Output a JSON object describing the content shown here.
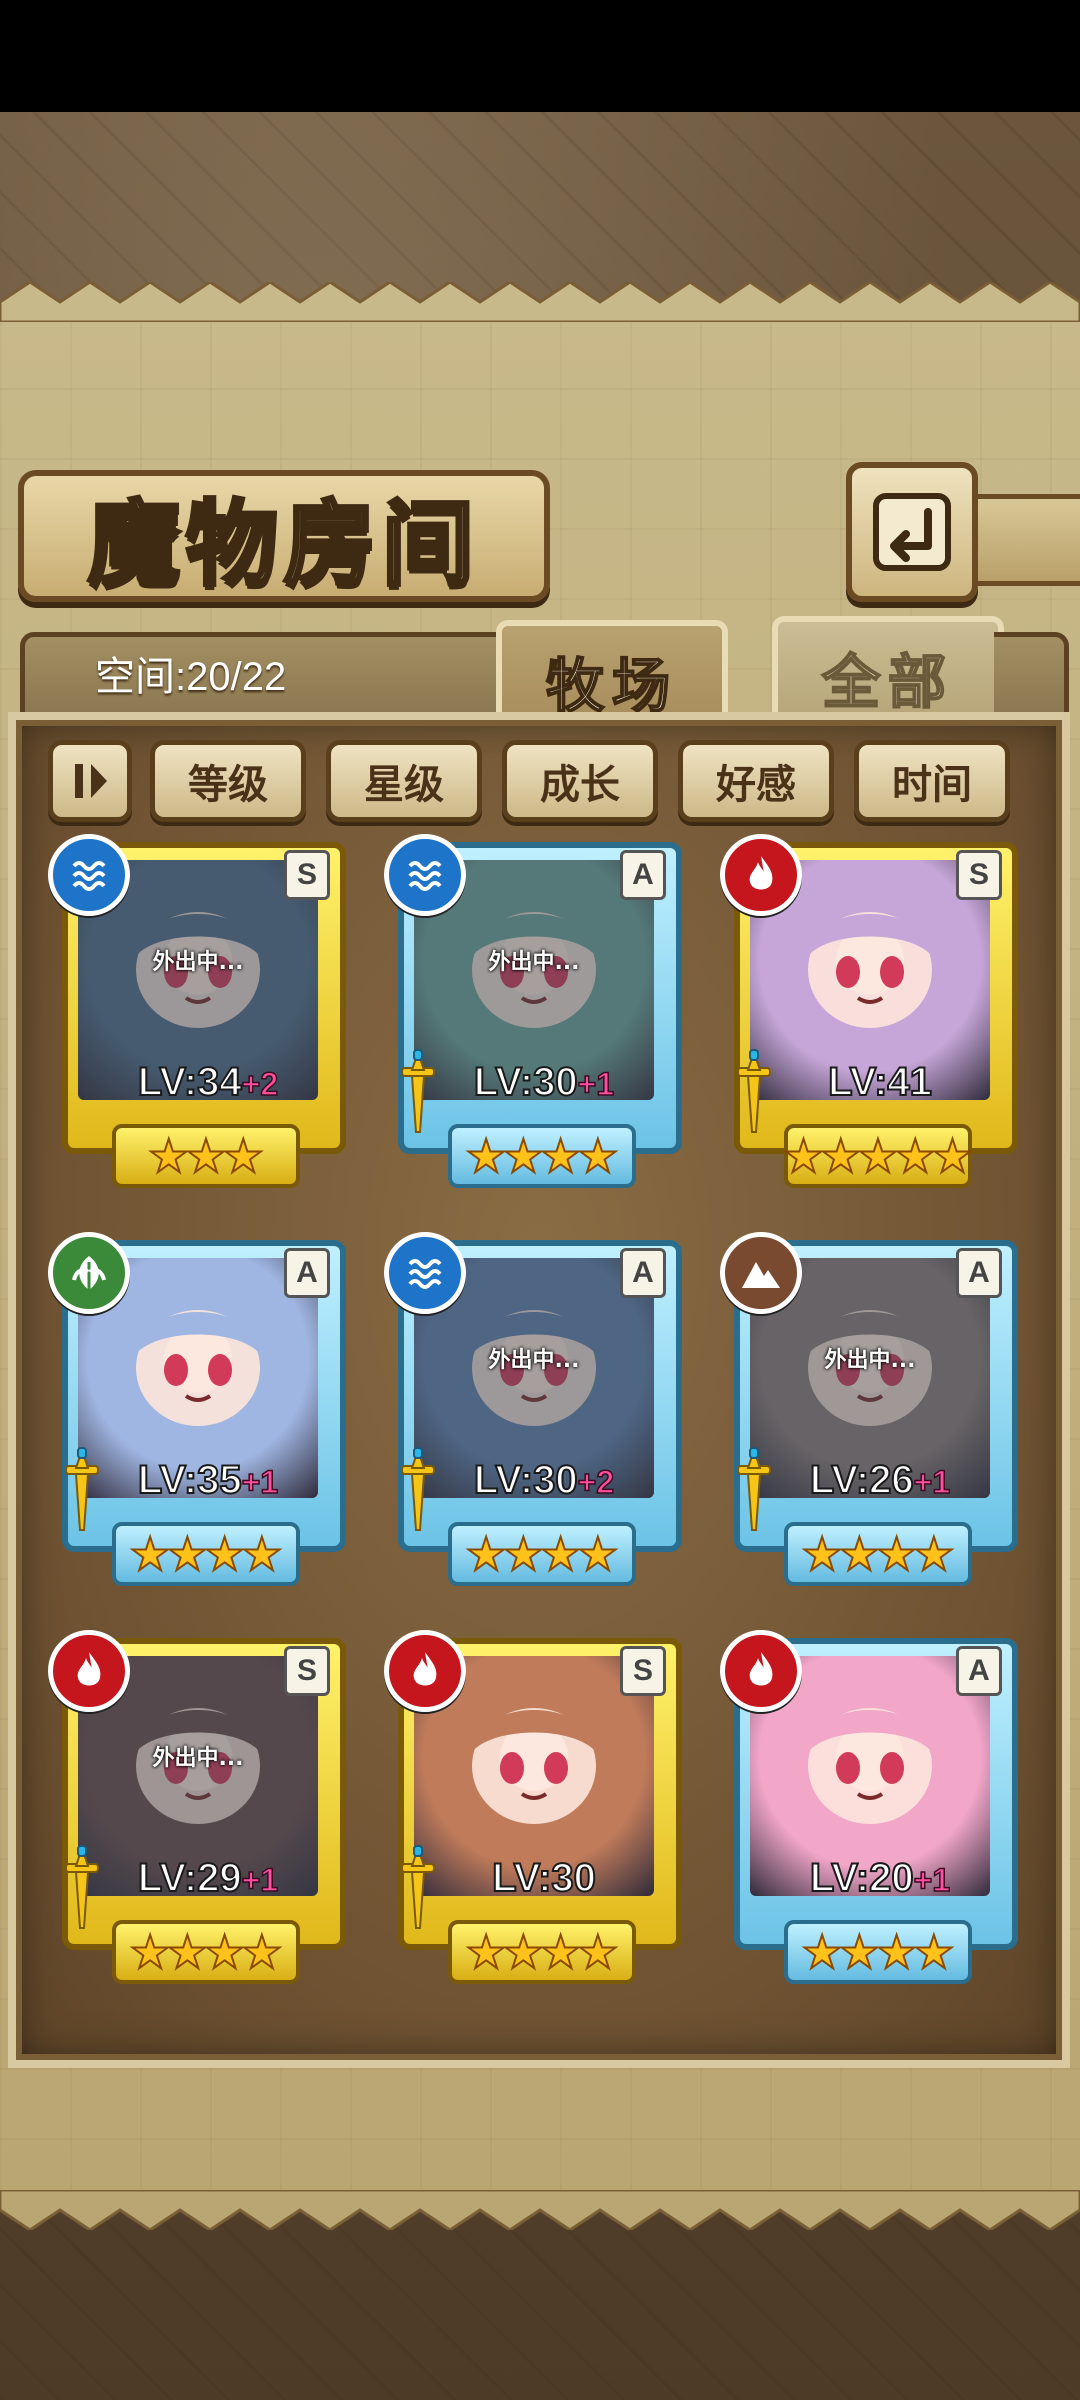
{
  "header": {
    "title": "魔物房间"
  },
  "space": {
    "label": "空间:20/22"
  },
  "tabs": [
    {
      "label": "牧场",
      "active": true
    },
    {
      "label": "全部",
      "active": false
    }
  ],
  "filters": [
    {
      "label": "等级"
    },
    {
      "label": "星级"
    },
    {
      "label": "成长"
    },
    {
      "label": "好感"
    },
    {
      "label": "时间"
    }
  ],
  "status_out": "外出中...",
  "monsters": [
    {
      "element": "water",
      "element_icon": "water-icon",
      "rank": "S",
      "level": "LV:34",
      "bonus": "+2",
      "stars": 3,
      "frame": "gold",
      "out": true,
      "weapon": false,
      "art_color": "#4f6c8a"
    },
    {
      "element": "water",
      "element_icon": "water-icon",
      "rank": "A",
      "level": "LV:30",
      "bonus": "+1",
      "stars": 4,
      "frame": "blue",
      "out": true,
      "weapon": true,
      "art_color": "#6aa39a"
    },
    {
      "element": "fire",
      "element_icon": "fire-icon",
      "rank": "S",
      "level": "LV:41",
      "bonus": "",
      "stars": 5,
      "frame": "gold",
      "out": false,
      "weapon": true,
      "art_color": "#c6a6d8"
    },
    {
      "element": "wind",
      "element_icon": "leaf-icon",
      "rank": "A",
      "level": "LV:35",
      "bonus": "+1",
      "stars": 4,
      "frame": "blue",
      "out": false,
      "weapon": true,
      "art_color": "#9fb6e2"
    },
    {
      "element": "water",
      "element_icon": "water-icon",
      "rank": "A",
      "level": "LV:30",
      "bonus": "+2",
      "stars": 4,
      "frame": "blue",
      "out": true,
      "weapon": true,
      "art_color": "#5d7fae"
    },
    {
      "element": "earth",
      "element_icon": "mountain-icon",
      "rank": "A",
      "level": "LV:26",
      "bonus": "+1",
      "stars": 4,
      "frame": "blue",
      "out": true,
      "weapon": true,
      "art_color": "#8a7a78"
    },
    {
      "element": "fire",
      "element_icon": "fire-icon",
      "rank": "S",
      "level": "LV:29",
      "bonus": "+1",
      "stars": 4,
      "frame": "gold",
      "out": true,
      "weapon": true,
      "art_color": "#6b4a4a"
    },
    {
      "element": "fire",
      "element_icon": "fire-icon",
      "rank": "S",
      "level": "LV:30",
      "bonus": "",
      "stars": 4,
      "frame": "gold",
      "out": false,
      "weapon": true,
      "art_color": "#c07b5a"
    },
    {
      "element": "fire",
      "element_icon": "fire-icon",
      "rank": "A",
      "level": "LV:20",
      "bonus": "+1",
      "stars": 4,
      "frame": "blue",
      "out": false,
      "weapon": false,
      "art_color": "#f2a6c8"
    }
  ]
}
